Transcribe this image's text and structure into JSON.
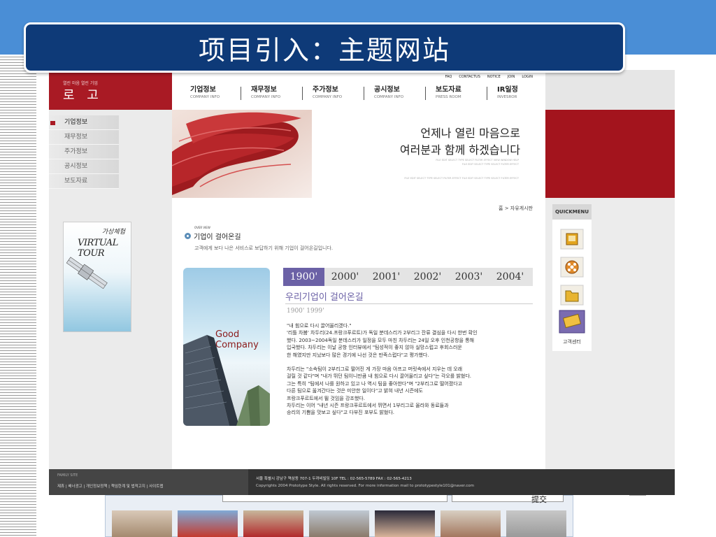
{
  "slide": {
    "title": "项目引入：主题网站",
    "submit_label": "提交"
  },
  "site": {
    "logo": {
      "sub": "열린 마음 열린 기업",
      "main": "로 고"
    },
    "util_links": [
      "FAQ",
      "CONTACTUS",
      "NOTICE",
      "JOIN",
      "LOGIN"
    ],
    "nav": [
      {
        "kr": "기업정보",
        "en": "COMPANY INFO"
      },
      {
        "kr": "재무정보",
        "en": "COMPANY INFO"
      },
      {
        "kr": "주가정보",
        "en": "COMPANY INFO"
      },
      {
        "kr": "공시정보",
        "en": "COMPANY INFO"
      },
      {
        "kr": "보도자료",
        "en": "PRESS ROOM"
      },
      {
        "kr": "IR일정",
        "en": "INVESROR"
      }
    ],
    "hero": {
      "line1": "언제나 열린 마음으로",
      "line2": "여러분과 함께 하겠습니다",
      "small1": "FILE EDIT SELECT TYPE SELECT FILTER EFFECT VIEW WINDOW HELP",
      "small2": "FILE EDIT SELECT TYPE SELECT FILTER EFFECT",
      "small3": "FILE EDIT SELECT TYPE SELECT FILTER EFFECT  FILE EDIT SELECT TYPE SELECT FILTER EFFECT"
    },
    "side_menu": [
      "기업정보",
      "재무정보",
      "주가정보",
      "공시정보",
      "보도자료"
    ],
    "virtual_tour": {
      "kr": "가상체험",
      "en": "VIRTUAL TOUR"
    },
    "breadcrumb": "홈 > 자유게시판",
    "section": {
      "small": "OVER VIEW",
      "title": "기업이 걸어온길",
      "desc": "고객에게 보다 나은 서비스로 보답하기 위해 기업이 걸어온길입니다."
    },
    "good_company": [
      "Good",
      "Company"
    ],
    "years": [
      "1900'",
      "2000'",
      "2001'",
      "2002'",
      "2003'",
      "2004'"
    ],
    "history": {
      "title": "우리기업이 걸어온길",
      "range": "1900'  1999'",
      "paragraphs": [
        "\"내 힘으로 다시 끌어올리겠다.\"\n'리틀 차붐' 차두리(24.프랑크푸르트)가 독일 분데스리가 2부리그 잔류 결심을 다시 한번 확인\n했다. 2003~2004독일 분데스리가 일정을 모두 마친 차두리는 24일 오후 인천공항을 통해\n입국했다. 차두리는 이날 공항 인터뷰에서 \"팀성적이 좋지 않아 실망스럽고 후회스러운\n한 해였지만 지났보다 많은 경기에 나선 것은 만족스럽다\"고 평가했다.",
        "차두리는 \"소속팀이 2부리그로 떨어진 게 가장 마음 아프고 머릿속에서 지우는 데 오래\n걸릴 것 같다\"며 \"내가 뛰던 팀이니만큼 내 힘으로 다시 끌어올리고 싶다\"는 각오를 밝혔다.\n그는 특히 \"팀에서 나를 원하고 있고 나 역시 팀을 좋아한다\"며 \"2부리그로 떨어졌다고\n다른 팀으로 옮겨간다는 것은 미안한 일이다\"고 밝혀 내년 시즌에도\n프랑크푸르트에서 뛸 것임을 강조했다.\n차두리는 이어 \"내년 시즌 프랑크푸르트에서 뛰면서 1부리그로 올라와 동료들과\n승리의 기쁨을 맛보고 싶다\"고 다부진 포부도 밝혔다."
      ]
    },
    "quickmenu": {
      "label": "QUICKMENU",
      "caption": "고객센터"
    },
    "footer": {
      "family": "FAMILY SITE",
      "links": "제휴  |  배너광고  |  개인정보정책  |  책임한계 및 법적고지  |  사이트맵",
      "address": "서울 특별시 강남구 역삼동 707-1 두꺼비빌딩 10F TEL : 02-565-5789 FAX : 02-565-4213",
      "copyright": "Copyrights 2004 Prototype Style. All rights reserved.  For more information mail to prototypestyle101@naver.com"
    }
  }
}
